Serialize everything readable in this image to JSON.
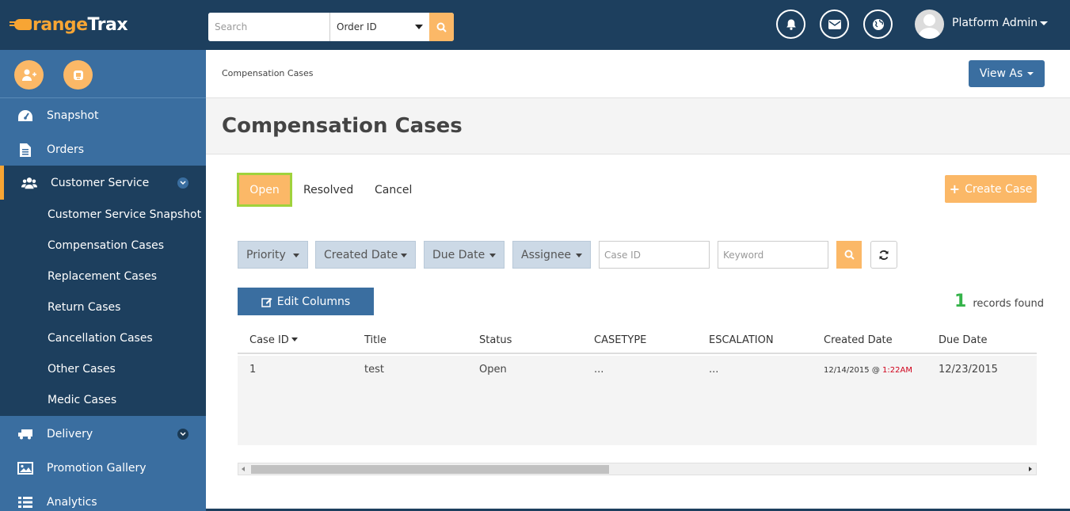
{
  "brand": {
    "logo_part1": "range",
    "logo_part2": "Trax",
    "accent": "#f7a534",
    "dark": "#1d3f5e",
    "sidebar": "#3a6ea0"
  },
  "topbar": {
    "search_placeholder": "Search",
    "search_type": "Order ID",
    "icons": [
      "bell-icon",
      "mail-icon",
      "globe-icon"
    ],
    "user_name": "Platform Admin"
  },
  "sidebar": {
    "quick_actions": [
      "add-user-icon",
      "support-icon"
    ],
    "items": [
      {
        "label": "Snapshot",
        "icon": "dashboard-icon"
      },
      {
        "label": "Orders",
        "icon": "document-icon"
      },
      {
        "label": "Customer Service",
        "icon": "users-icon",
        "active": true
      },
      {
        "label": "Delivery",
        "icon": "truck-icon"
      },
      {
        "label": "Promotion Gallery",
        "icon": "image-icon"
      },
      {
        "label": "Analytics",
        "icon": "list-icon"
      }
    ],
    "submenu": [
      "Customer Service Snapshot",
      "Compensation Cases",
      "Replacement Cases",
      "Return Cases",
      "Cancellation Cases",
      "Other Cases",
      "Medic Cases"
    ]
  },
  "main": {
    "breadcrumb": "Compensation Cases",
    "view_as": "View As",
    "title": "Compensation Cases",
    "tabs": [
      "Open",
      "Resolved",
      "Cancel"
    ],
    "create_case": "Create Case",
    "filters": {
      "priority": "Priority",
      "created_date": "Created Date",
      "due_date": "Due Date",
      "assignee": "Assignee",
      "case_id_placeholder": "Case ID",
      "keyword_placeholder": "Keyword"
    },
    "edit_columns": "Edit Columns",
    "records_count": "1",
    "records_label": "records found",
    "table": {
      "columns": [
        "Case ID",
        "Title",
        "Status",
        "CASETYPE",
        "ESCALATION",
        "Created Date",
        "Due Date"
      ],
      "rows": [
        {
          "case_id": "1",
          "title": "test",
          "status": "Open",
          "casetype": "...",
          "escalation": "...",
          "created_date": "12/14/2015 @",
          "created_time": "1:22AM",
          "due_date": "12/23/2015"
        }
      ]
    }
  }
}
